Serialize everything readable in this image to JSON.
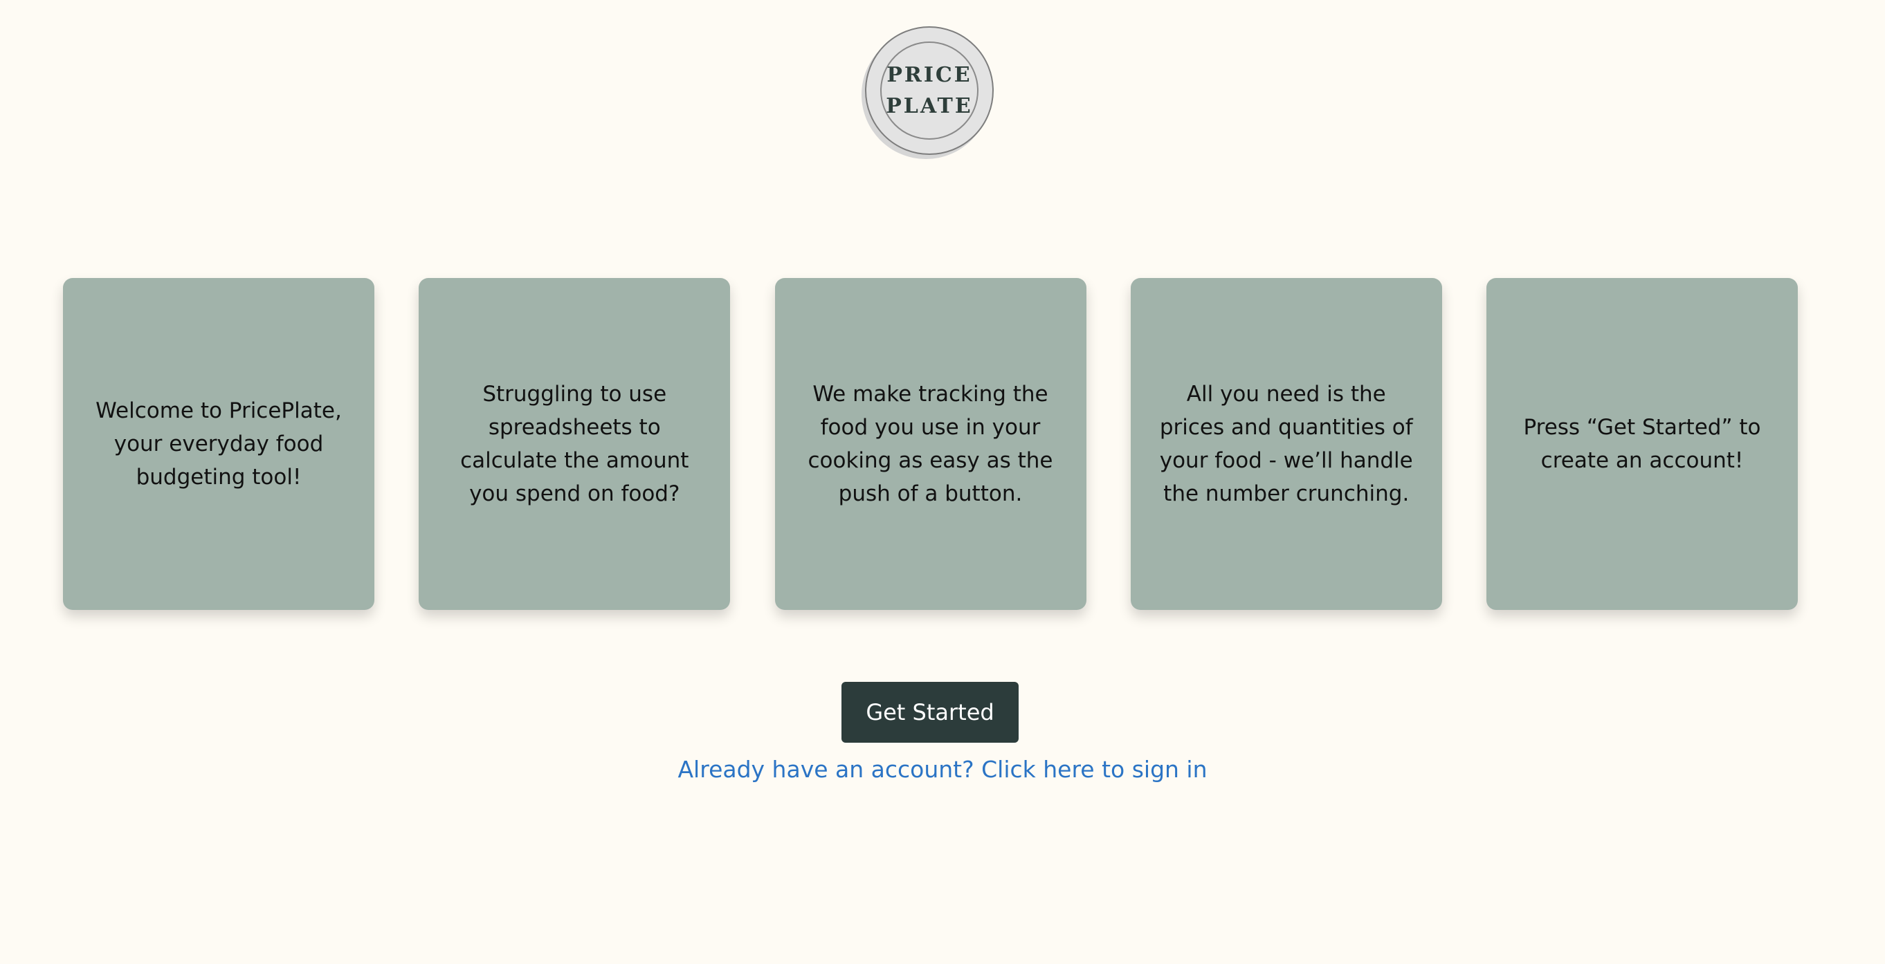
{
  "logo": {
    "line1": "PRICE",
    "line2": "PLATE"
  },
  "cards": [
    "Welcome to PricePlate, your everyday food budgeting tool!",
    "Struggling to use spreadsheets to calculate the amount you spend on food?",
    "We make tracking the food you use in your cooking as easy as the push of a button.",
    "All you need is the prices and quantities of your food - we’ll handle the number crunching.",
    "Press “Get Started” to create an account!"
  ],
  "cta": {
    "label": "Get Started"
  },
  "signin": {
    "label": "Already have an account? Click here to sign in"
  },
  "colors": {
    "background": "#fefbf4",
    "card": "#a1b3aa",
    "button": "#2c3c3b",
    "link": "#2b74c5"
  }
}
